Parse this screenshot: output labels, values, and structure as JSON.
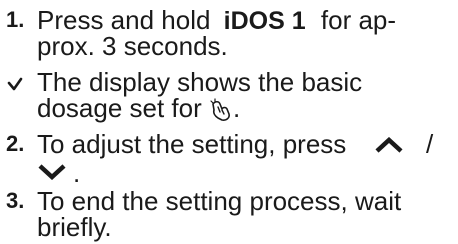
{
  "steps": [
    {
      "marker": "1.",
      "line1_pre": "Press and hold ",
      "key": "iDOS 1",
      "line1_post": " for ap-",
      "line2": "prox. 3 seconds."
    },
    {
      "marker": "2.",
      "line1": "To adjust the setting, press",
      "separator": "/",
      "line2_post": "."
    },
    {
      "marker": "3.",
      "line1": "To end the setting process, wait",
      "line2": "briefly."
    }
  ],
  "result": {
    "line1": "The display shows the basic",
    "line2_pre": "dosage set for ",
    "line2_post": "."
  },
  "icons": {
    "result_marker": "checkmark-icon",
    "dosage": "dosage-hand-icon",
    "up": "arrow-up-icon",
    "down": "arrow-down-icon"
  }
}
